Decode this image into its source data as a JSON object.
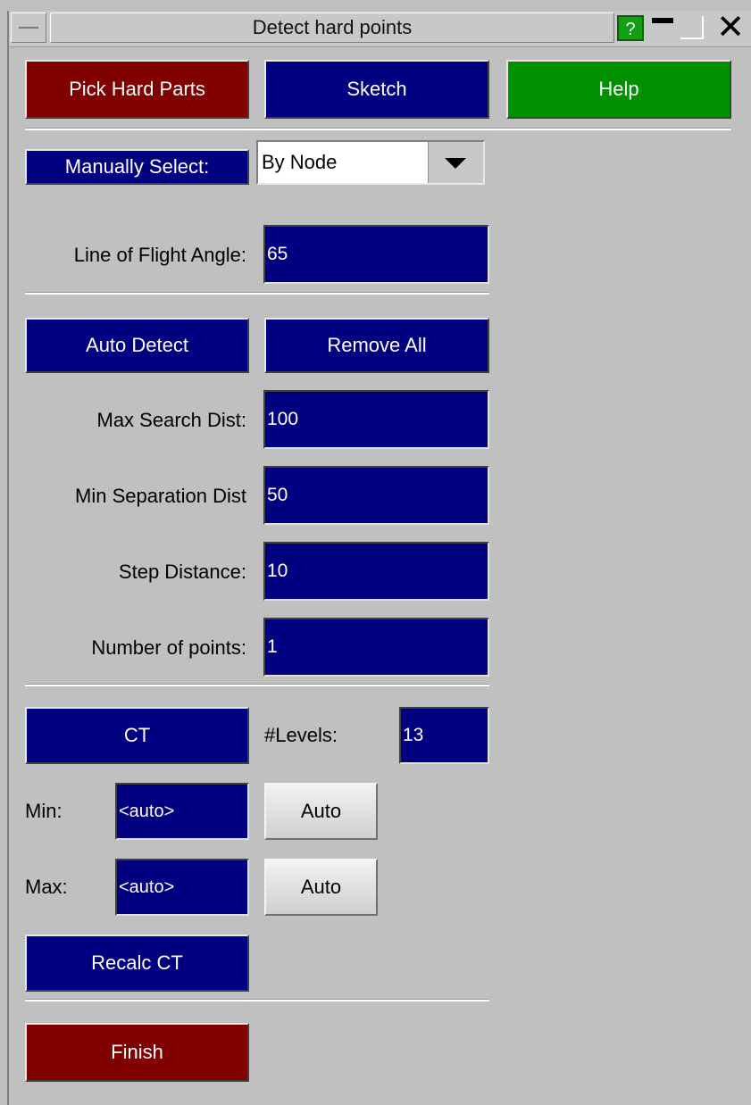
{
  "window": {
    "title": "Detect hard points",
    "help_label": "?"
  },
  "top_buttons": {
    "pick_hard_parts": "Pick Hard Parts",
    "sketch": "Sketch",
    "help": "Help"
  },
  "manual": {
    "select_label": "Manually Select:",
    "select_value": "By Node",
    "lof_label": "Line of Flight Angle:",
    "lof_value": "65"
  },
  "auto": {
    "auto_detect": "Auto Detect",
    "remove_all": "Remove All",
    "max_search_label": "Max Search Dist:",
    "max_search_value": "100",
    "min_sep_label": "Min Separation Dist",
    "min_sep_value": "50",
    "step_label": "Step Distance:",
    "step_value": "10",
    "num_points_label": "Number of points:",
    "num_points_value": "1"
  },
  "ct": {
    "ct_button": "CT",
    "levels_label": "#Levels:",
    "levels_value": "13",
    "min_label": "Min:",
    "min_value": "<auto>",
    "min_auto": "Auto",
    "max_label": "Max:",
    "max_value": "<auto>",
    "max_auto": "Auto",
    "recalc": "Recalc CT"
  },
  "finish": "Finish"
}
